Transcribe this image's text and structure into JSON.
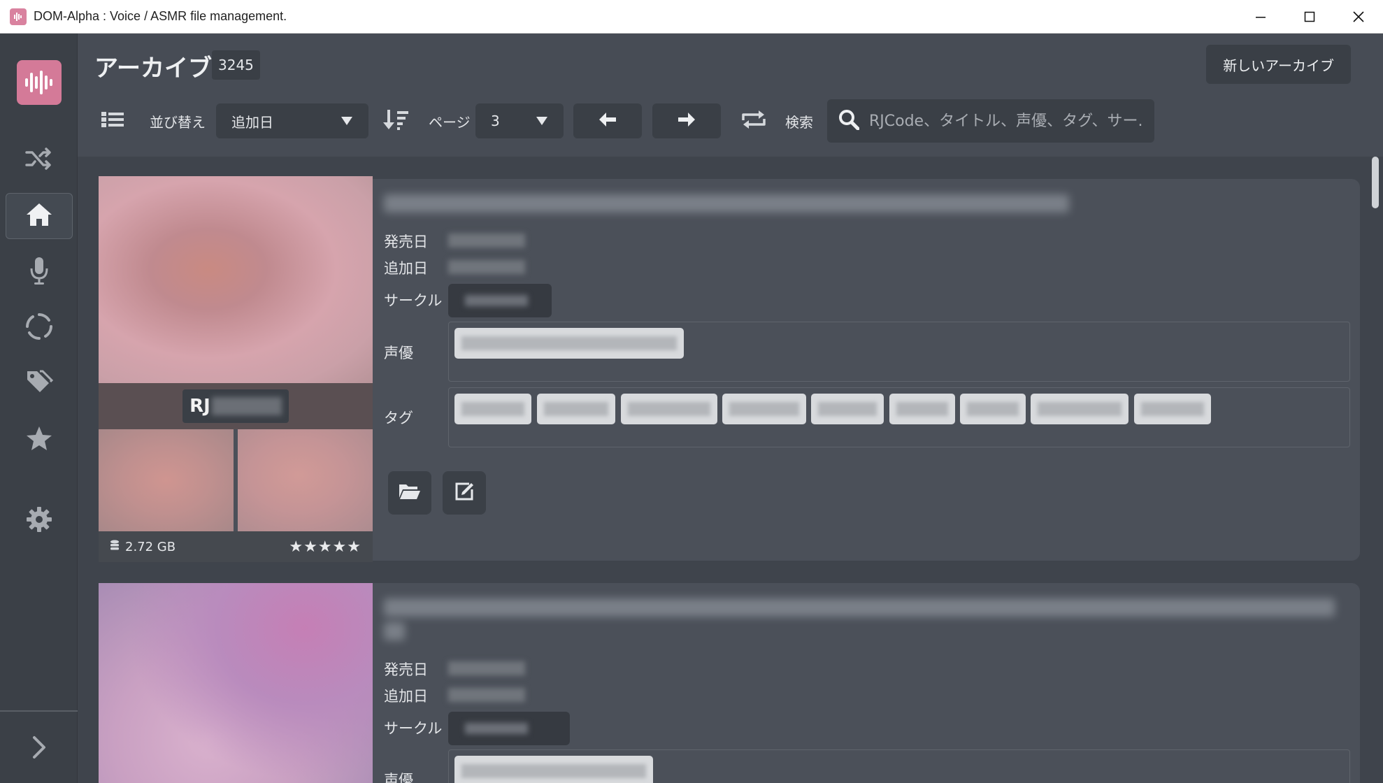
{
  "window": {
    "title": "DOM-Alpha : Voice / ASMR file management.",
    "controls": [
      "minimize",
      "maximize",
      "close"
    ]
  },
  "sidebar": {
    "items": [
      {
        "name": "shuffle-icon",
        "active": false
      },
      {
        "name": "home-icon",
        "active": true
      },
      {
        "name": "microphone-icon",
        "active": false
      },
      {
        "name": "circle-dashed-icon",
        "active": false
      },
      {
        "name": "tags-icon",
        "active": false
      },
      {
        "name": "star-icon",
        "active": false
      },
      {
        "name": "gear-icon",
        "active": false
      }
    ],
    "expand_icon": "chevron-right-icon"
  },
  "header": {
    "title": "アーカイブ",
    "count": "3245",
    "new_archive_label": "新しいアーカイブ"
  },
  "toolbar": {
    "sort_label": "並び替え",
    "sort_value": "追加日",
    "page_label": "ページ",
    "page_value": "3",
    "search_label": "検索",
    "search_placeholder": "RJCode、タイトル、声優、タグ、サー..."
  },
  "cards": [
    {
      "rj_prefix": "RJ",
      "size": "2.72 GB",
      "rating": "★★★★★",
      "labels": {
        "release": "発売日",
        "added": "追加日",
        "circle": "サークル",
        "cv": "声優",
        "tags": "タグ"
      }
    },
    {
      "labels": {
        "release": "発売日",
        "added": "追加日",
        "circle": "サークル",
        "cv": "声優"
      }
    }
  ],
  "colors": {
    "accent": "#d47a98",
    "background": "#3f444c",
    "card": "#4b5059",
    "control": "#3a3f46"
  }
}
